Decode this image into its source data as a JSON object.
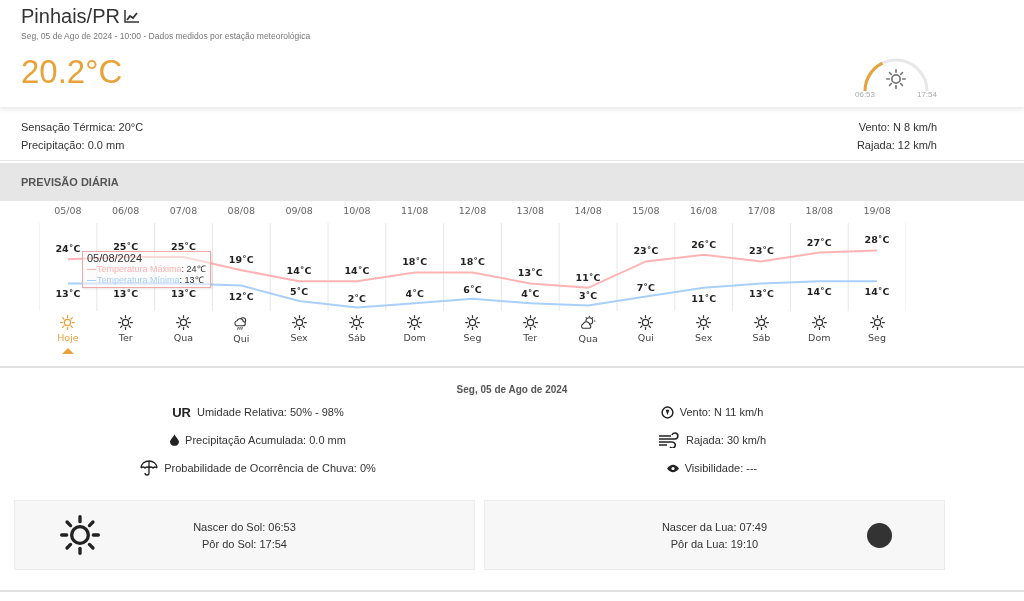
{
  "location": {
    "title": "Pinhais/PR",
    "subtitle": "Seg, 05 de Ago de 2024 - 10:00 - Dados medidos por estação meteorológica",
    "temperature": "20.2°C"
  },
  "sun_gauge": {
    "level": 0.28,
    "sunrise": "06:53",
    "sunset": "17:54"
  },
  "conditions_left": [
    "Sensação Térmica: 20°C",
    "Precipitação: 0.0 mm"
  ],
  "conditions_right": [
    "Vento: N 8 km/h",
    "Rajada: 12 km/h"
  ],
  "forecast": {
    "title": "PREVISÃO DIÁRIA",
    "days": [
      {
        "day": "Hoje",
        "kind": "sun",
        "selected": true
      },
      {
        "day": "Ter",
        "kind": "sun",
        "selected": false
      },
      {
        "day": "Qua",
        "kind": "sun",
        "selected": false
      },
      {
        "day": "Qui",
        "kind": "rain",
        "selected": false
      },
      {
        "day": "Sex",
        "kind": "sun",
        "selected": false
      },
      {
        "day": "Sáb",
        "kind": "sun",
        "selected": false
      },
      {
        "day": "Dom",
        "kind": "sun",
        "selected": false
      },
      {
        "day": "Seg",
        "kind": "sun",
        "selected": false
      },
      {
        "day": "Ter",
        "kind": "sun",
        "selected": false
      },
      {
        "day": "Qua",
        "kind": "partly_cloudy",
        "selected": false
      },
      {
        "day": "Qui",
        "kind": "sun",
        "selected": false
      },
      {
        "day": "Sex",
        "kind": "sun",
        "selected": false
      },
      {
        "day": "Sáb",
        "kind": "sun",
        "selected": false
      },
      {
        "day": "Dom",
        "kind": "sun",
        "selected": false
      },
      {
        "day": "Seg",
        "kind": "sun",
        "selected": false
      }
    ],
    "chart_data": {
      "type": "line",
      "categories": [
        "05/08",
        "06/08",
        "07/08",
        "08/08",
        "09/08",
        "10/08",
        "11/08",
        "12/08",
        "13/08",
        "14/08",
        "15/08",
        "16/08",
        "17/08",
        "18/08",
        "19/08"
      ],
      "series": [
        {
          "name": "Temperatura Máxima",
          "color": "#ffb3b3",
          "values": [
            24,
            25,
            25,
            19,
            14,
            14,
            18,
            18,
            13,
            11,
            23,
            26,
            23,
            27,
            28
          ],
          "value_labels": [
            "24˚C",
            "25˚C",
            "25˚C",
            "19˚C",
            "14˚C",
            "14˚C",
            "18˚C",
            "18˚C",
            "13˚C",
            "11˚C",
            "23˚C",
            "26˚C",
            "23˚C",
            "27˚C",
            "28˚C"
          ]
        },
        {
          "name": "Temperatura Mínima",
          "color": "#a8d0fa",
          "values": [
            13,
            13,
            13,
            12,
            5,
            2,
            4,
            6,
            4,
            3,
            7,
            11,
            13,
            14,
            14
          ],
          "value_labels": [
            "13˚C",
            "13˚C",
            "13˚C",
            "12˚C",
            "5˚C",
            "2˚C",
            "4˚C",
            "6˚C",
            "4˚C",
            "3˚C",
            "7˚C",
            "11˚C",
            "13˚C",
            "14˚C",
            "14˚C"
          ]
        }
      ]
    },
    "tooltip": {
      "date": "05/08/2024",
      "values": [
        ": 24℃",
        ": 13℃"
      ]
    }
  },
  "details": {
    "date": "Seg, 05 de Ago de 2024",
    "left": [
      {
        "kind": "badge",
        "badge": "UR",
        "text": "Umidade Relativa: 50% - 98%"
      },
      {
        "kind": "drop",
        "text": "Precipitação Acumulada: 0.0 mm"
      },
      {
        "kind": "umbrella",
        "text": "Probabilidade de Ocorrência de Chuva: 0%"
      }
    ],
    "right": [
      {
        "kind": "compass",
        "text": "Vento: N 11 km/h"
      },
      {
        "kind": "wind",
        "text": "Rajada: 30 km/h"
      },
      {
        "kind": "eye",
        "text": "Visibilidade: ---"
      }
    ]
  },
  "cards": [
    {
      "kind": "sun",
      "lines": [
        "Nascer do Sol: 06:53",
        "Pôr do Sol: 17:54"
      ]
    },
    {
      "kind": "moon",
      "lines": [
        "Nascer da Lua: 07:49",
        "Pôr da Lua: 19:10"
      ]
    }
  ]
}
